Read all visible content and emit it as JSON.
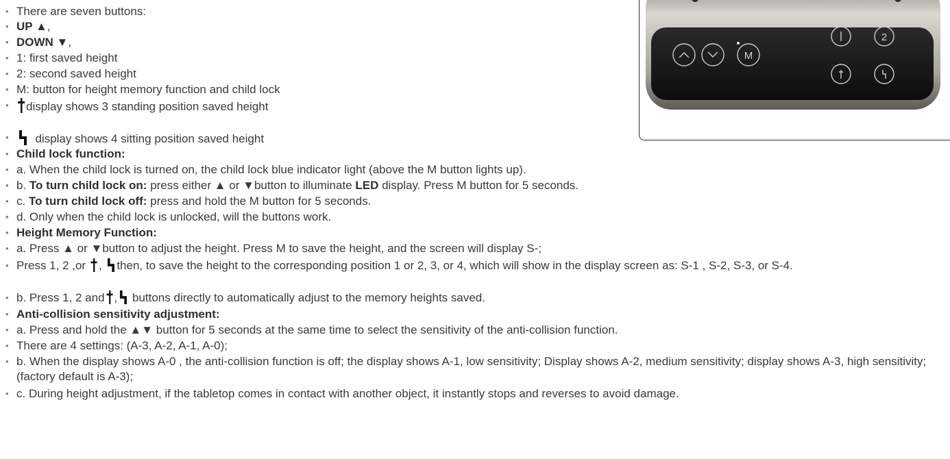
{
  "lines": [
    {
      "bold": "",
      "text": "There are seven buttons:"
    },
    {
      "bold": "UP ▲",
      "text": ","
    },
    {
      "bold": "DOWN ▼",
      "text": ","
    },
    {
      "bold": "",
      "text": "1: first saved height"
    },
    {
      "bold": "",
      "text": "2: second saved height"
    },
    {
      "bold": "",
      "text": "M: button for height memory function and child lock"
    },
    {
      "bold": "",
      "text": "display shows 3 standing position saved height"
    },
    {
      "bold": "",
      "text": "display shows 4 sitting position saved height"
    },
    {
      "bold": "Child lock function:",
      "text": ""
    },
    {
      "bold": "",
      "text": "a. When the child lock is turned on, the child lock blue indicator light (above the M button lights up)."
    },
    {
      "pre": "b. ",
      "bold": "To turn child lock on:",
      "text": " press either ▲ or ▼button to illuminate ",
      "bold2": "LED",
      "text2": " display. Press M button for 5 seconds."
    },
    {
      "pre": "c. ",
      "bold": "To turn child lock off:",
      "text": " press and hold the M button for 5 seconds."
    },
    {
      "bold": "",
      "text": "d. Only when the child lock is unlocked, will the buttons work."
    },
    {
      "bold": "Height Memory Function:",
      "text": ""
    },
    {
      "bold": "",
      "text": "a. Press ▲ or ▼button to adjust the height. Press M to save the height, and the screen will display S-;"
    },
    {
      "pre": "Press 1, 2 ,or",
      "mid": ",",
      "text": "then, to save the height to the corresponding position 1 or 2, 3, or 4, which will show in the display screen as: S-1 , S-2, S-3, or S-4."
    },
    {
      "pre": "b. Press 1, 2 and",
      "mid": ",",
      "text": "buttons directly to automatically adjust to the memory heights saved."
    },
    {
      "bold": "Anti-collision sensitivity adjustment:",
      "text": ""
    },
    {
      "bold": "",
      "text": "a. Press and hold the ▲▼ button for 5 seconds at the same time to select  the sensitivity of the anti-collision function."
    },
    {
      "bold": "",
      "text": "There are 4 settings: (A-3, A-2, A-1, A-0);"
    },
    {
      "bold": "",
      "text": "b. When the display shows A-0 , the anti-collision function is off; the display shows A-1, low sensitivity; Display shows A-2, medium sensitivity; display shows A-3, high sensitivity; (factory default is A-3);"
    },
    {
      "bold": "",
      "text": "c. During height adjustment, if the tabletop comes in contact with another object, it instantly stops and reverses to avoid damage."
    }
  ],
  "panel": {
    "buttons": [
      "∧",
      "∨",
      "M",
      "1",
      "2"
    ],
    "colors": {
      "body": "#1a1a1a",
      "frame": "#b8b4ae",
      "ring": "#cfcfcf"
    }
  }
}
